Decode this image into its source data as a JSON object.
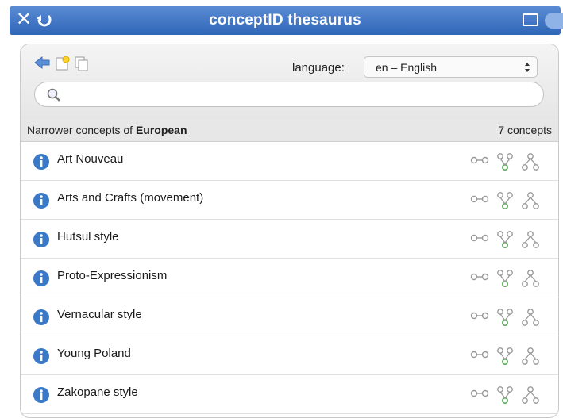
{
  "window": {
    "title": "conceptID thesaurus"
  },
  "toolbar": {
    "language_label": "language:",
    "language_value": "en – English"
  },
  "search": {
    "placeholder": ""
  },
  "list_header": {
    "prefix": "Narrower concepts of ",
    "term": "European",
    "count": "7 concepts"
  },
  "concepts": [
    {
      "label": "Art Nouveau"
    },
    {
      "label": "Arts and Crafts (movement)"
    },
    {
      "label": "Hutsul style"
    },
    {
      "label": "Proto-Expressionism"
    },
    {
      "label": "Vernacular style"
    },
    {
      "label": "Young Poland"
    },
    {
      "label": "Zakopane style"
    }
  ],
  "icons": {
    "close": "close-icon",
    "back": "refresh-back-icon",
    "resize": "resize-icon",
    "nav_back": "back-arrow-icon",
    "new_note": "new-note-icon",
    "copy": "copy-icon",
    "search": "search-icon",
    "info": "info-icon",
    "link": "link-icon",
    "narrower": "narrower-tree-icon",
    "broader": "broader-tree-icon"
  },
  "colors": {
    "titlebar": "#2f66b8",
    "info_blue": "#3a78c8",
    "header_bg": "#e7e7e7"
  }
}
